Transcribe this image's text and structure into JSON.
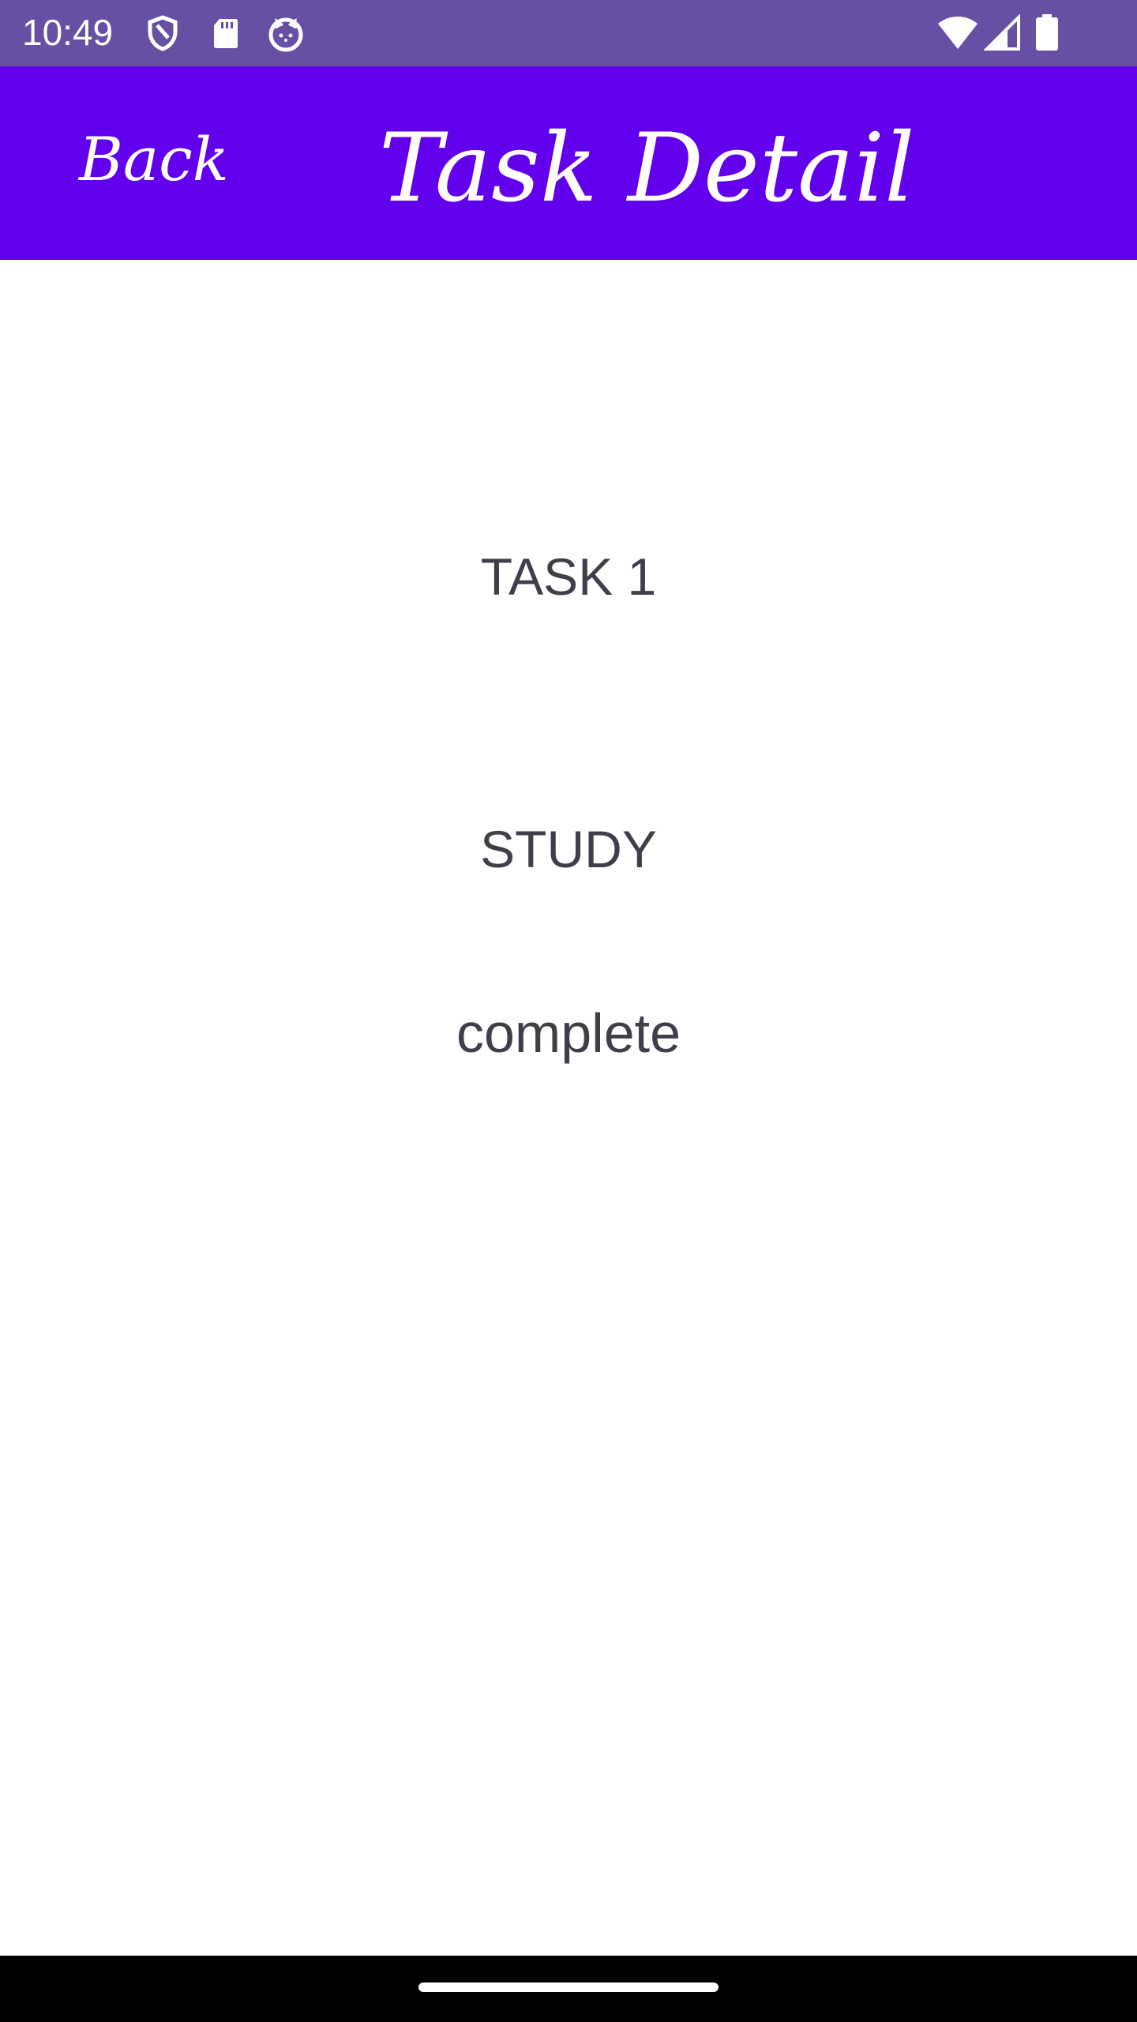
{
  "status_bar": {
    "time": "10:49",
    "icons_left": [
      "shield-icon",
      "sd-card-icon",
      "cat-face-icon"
    ],
    "icons_right": [
      "wifi-icon",
      "cellular-signal-icon",
      "battery-icon"
    ],
    "background": "#6750a4"
  },
  "app_bar": {
    "back_label": "Back",
    "title": "Task Detail",
    "background": "#6200ee"
  },
  "task": {
    "name": "TASK 1",
    "category": "STUDY",
    "status": "complete"
  },
  "nav_bar": {
    "background": "#000000"
  }
}
